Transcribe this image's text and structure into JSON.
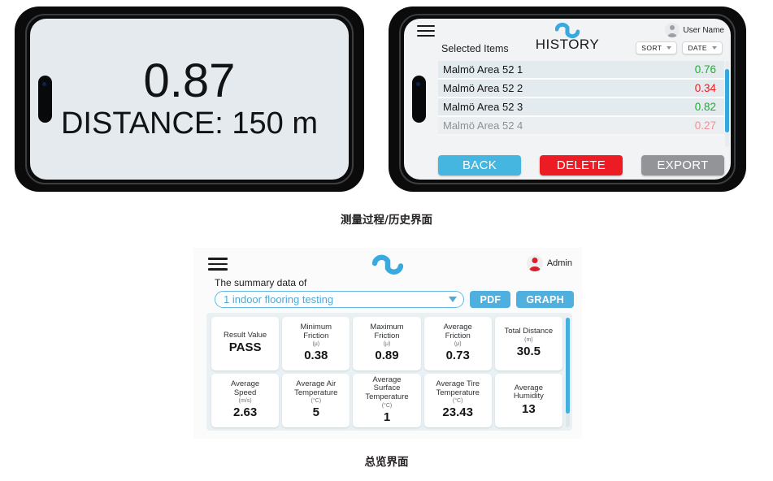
{
  "colors": {
    "accent_blue": "#45b6e0",
    "danger_red": "#ed1c24",
    "neutral_gray": "#929497",
    "good_green": "#1eae2f",
    "bad_red": "#ef1b21",
    "phone_bezel": "#0b0b0c",
    "screen_bg": "#e4eaed"
  },
  "captions": {
    "top": "测量过程/历史界面",
    "bottom": "总览界面"
  },
  "measure_screen": {
    "value": "0.87",
    "distance_line": "DISTANCE: 150 m"
  },
  "history_screen": {
    "menu_icon": "hamburger-icon",
    "logo_icon": "wave-logo-icon",
    "title": "HISTORY",
    "user": {
      "avatar_icon": "user-avatar-icon",
      "name": "User Name"
    },
    "selected_items_label": "Selected Items",
    "controls": [
      {
        "label": "SORT",
        "caret_icon": "caret-down-icon"
      },
      {
        "label": "DATE",
        "caret_icon": "caret-down-icon"
      }
    ],
    "rows": [
      {
        "name": "Malmö Area 52 1",
        "value": "0.76",
        "status": "good"
      },
      {
        "name": "Malmö Area 52 2",
        "value": "0.34",
        "status": "bad"
      },
      {
        "name": "Malmö Area 52 3",
        "value": "0.82",
        "status": "good"
      },
      {
        "name": "Malmö Area 52 4",
        "value": "0.27",
        "status": "bad"
      }
    ],
    "actions": [
      {
        "label": "BACK",
        "style": "back"
      },
      {
        "label": "DELETE",
        "style": "delete"
      },
      {
        "label": "EXPORT",
        "style": "export"
      }
    ]
  },
  "summary_screen": {
    "menu_icon": "hamburger-icon",
    "logo_icon": "wave-logo-icon",
    "user": {
      "avatar_icon": "admin-avatar-icon",
      "name": "Admin"
    },
    "subtitle": "The summary data of",
    "select": {
      "value": "1 indoor flooring testing",
      "caret_icon": "caret-down-icon"
    },
    "buttons": [
      {
        "label": "PDF"
      },
      {
        "label": "GRAPH"
      }
    ],
    "cards": [
      {
        "label": "Result Value",
        "unit": "",
        "value": "PASS"
      },
      {
        "label": "Minimum\nFriction",
        "unit": "(μ)",
        "value": "0.38"
      },
      {
        "label": "Maximum\nFriction",
        "unit": "(μ)",
        "value": "0.89"
      },
      {
        "label": "Average\nFriction",
        "unit": "(μ)",
        "value": "0.73"
      },
      {
        "label": "Total Distance",
        "unit": "(m)",
        "value": "30.5"
      },
      {
        "label": "Average\nSpeed",
        "unit": "(m/s)",
        "value": "2.63"
      },
      {
        "label": "Average Air\nTemperature",
        "unit": "(°C)",
        "value": "5"
      },
      {
        "label": "Average\nSurface\nTemperature",
        "unit": "(°C)",
        "value": "1"
      },
      {
        "label": "Average Tire\nTemperature",
        "unit": "(°C)",
        "value": "23.43"
      },
      {
        "label": "Average\nHumidity",
        "unit": "",
        "value": "13"
      }
    ]
  }
}
